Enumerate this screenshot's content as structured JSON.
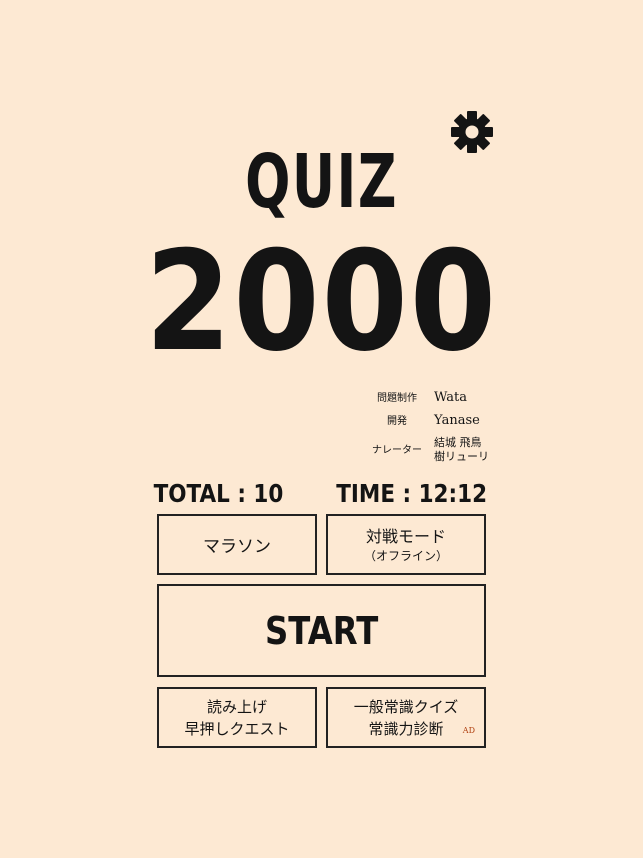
{
  "app": {
    "title_line1": "QUIZ",
    "title_line2": "2000"
  },
  "settings": {
    "icon": "gear-icon"
  },
  "credits": [
    {
      "role": "問題制作",
      "name": "Wata"
    },
    {
      "role": "開発",
      "name": "Yanase"
    },
    {
      "role": "ナレーター",
      "name": "結城 飛鳥\n樹リューリ"
    }
  ],
  "stats": {
    "total": "TOTAL : 10",
    "time": "TIME : 12:12"
  },
  "buttons": {
    "marathon": "マラソン",
    "versus_main": "対戦モード",
    "versus_sub": "（オフライン）",
    "start": "START",
    "reading_line1": "読み上げ",
    "reading_line2": "早押しクエスト",
    "ad_line1": "一般常識クイズ",
    "ad_line2": "常識力診断",
    "ad_badge": "AD"
  },
  "colors": {
    "background": "#fde9d3",
    "ink": "#141414",
    "ad_badge": "#b04010"
  }
}
